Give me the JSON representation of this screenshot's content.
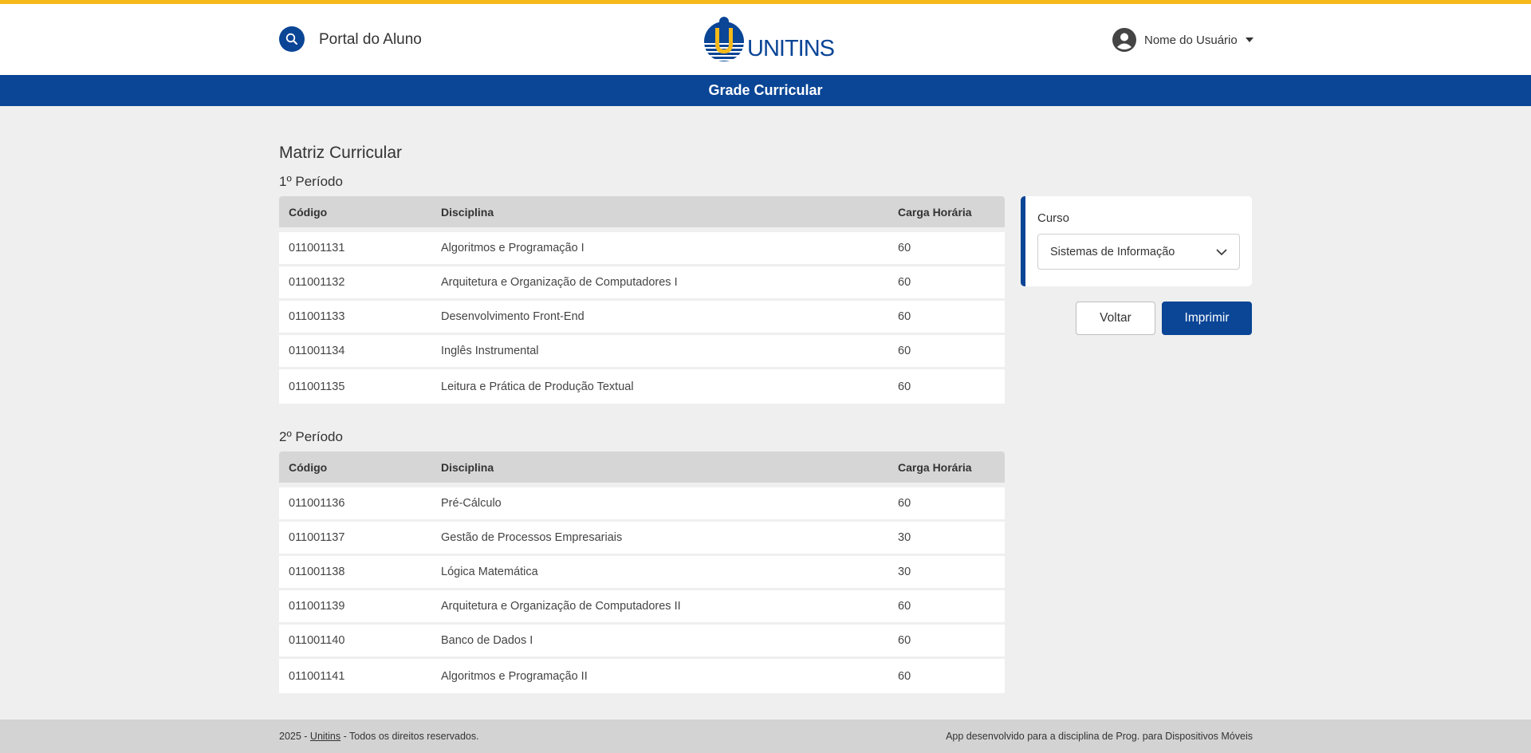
{
  "colors": {
    "accent_top": "#f6b91a",
    "brand_blue": "#0a4596",
    "background": "#efefef"
  },
  "header": {
    "search_icon": "search-icon",
    "portal_title": "Portal do Aluno",
    "logo_text": "UNITINS",
    "user_icon": "user-circle-icon",
    "user_name": "Nome do Usuário"
  },
  "page_bar": {
    "title": "Grade Curricular"
  },
  "main": {
    "title": "Matriz Curricular",
    "periods": [
      {
        "title": "1º Período",
        "columns": [
          "Código",
          "Disciplina",
          "Carga Horária"
        ],
        "rows": [
          [
            "011001131",
            "Algoritmos e Programação I",
            "60"
          ],
          [
            "011001132",
            "Arquitetura e Organização de Computadores I",
            "60"
          ],
          [
            "011001133",
            "Desenvolvimento Front-End",
            "60"
          ],
          [
            "011001134",
            "Inglês Instrumental",
            "60"
          ],
          [
            "011001135",
            "Leitura e Prática de Produção Textual",
            "60"
          ]
        ]
      },
      {
        "title": "2º Período",
        "columns": [
          "Código",
          "Disciplina",
          "Carga Horária"
        ],
        "rows": [
          [
            "011001136",
            "Pré-Cálculo",
            "60"
          ],
          [
            "011001137",
            "Gestão de Processos Empresariais",
            "30"
          ],
          [
            "011001138",
            "Lógica Matemática",
            "30"
          ],
          [
            "011001139",
            "Arquitetura e Organização de Computadores II",
            "60"
          ],
          [
            "011001140",
            "Banco de Dados I",
            "60"
          ],
          [
            "011001141",
            "Algoritmos e Programação II",
            "60"
          ]
        ]
      }
    ]
  },
  "sidebar": {
    "course_label": "Curso",
    "course_value": "Sistemas de Informação",
    "back_label": "Voltar",
    "print_label": "Imprimir"
  },
  "footer": {
    "left_prefix": "2025 - ",
    "left_link": "Unitins",
    "left_suffix": " - Todos os direitos reservados.",
    "right_text": "App desenvolvido para a disciplina de Prog. para Dispositivos Móveis"
  }
}
